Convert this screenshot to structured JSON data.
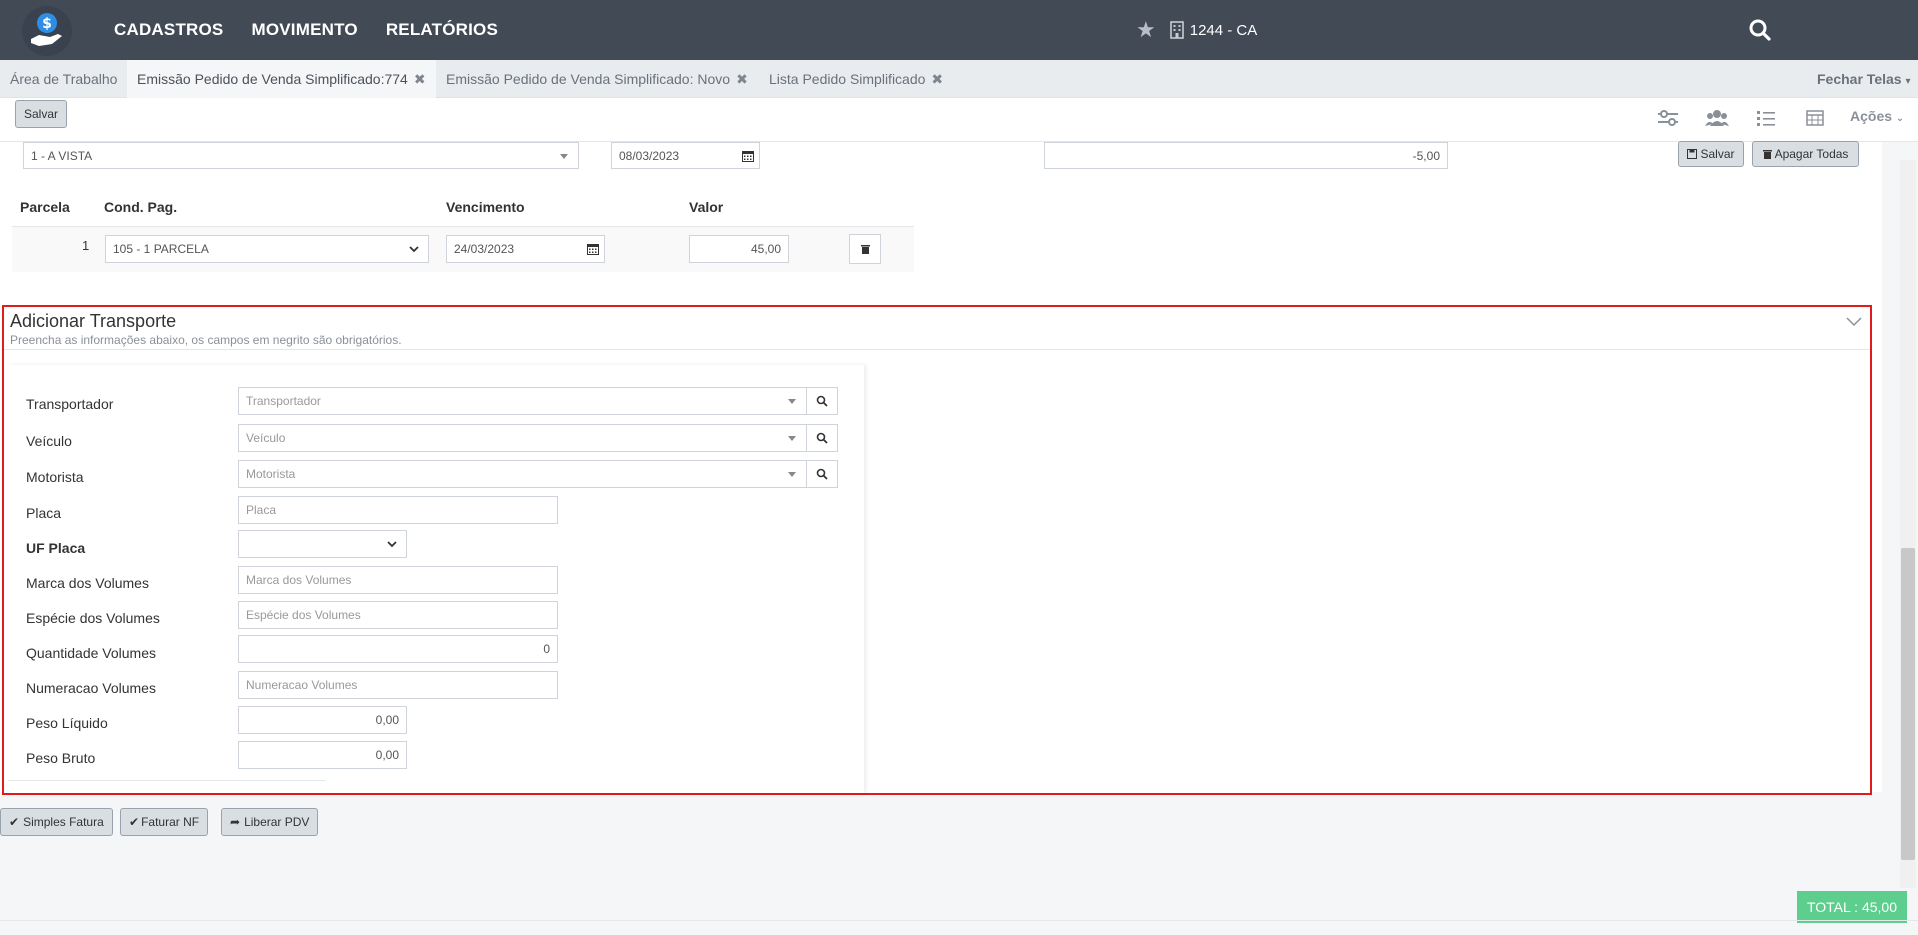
{
  "nav": {
    "menu": [
      "CADASTROS",
      "MOVIMENTO",
      "RELATÓRIOS"
    ],
    "company": "1244 - CA"
  },
  "tabs": {
    "items": [
      {
        "label": "Área de Trabalho"
      },
      {
        "label": "Emissão Pedido de Venda Simplificado:774"
      },
      {
        "label": "Emissão Pedido de Venda Simplificado: Novo"
      },
      {
        "label": "Lista Pedido Simplificado"
      }
    ],
    "close_all": "Fechar Telas"
  },
  "toolbar": {
    "save": "Salvar",
    "actions": "Ações"
  },
  "payment": {
    "cond_top": "1 - A VISTA",
    "date_top": "08/03/2023",
    "value_top": "-5,00",
    "save_btn": "Salvar",
    "delete_all_btn": "Apagar Todas",
    "headers": {
      "parcela": "Parcela",
      "cond": "Cond. Pag.",
      "venc": "Vencimento",
      "valor": "Valor"
    },
    "rows": [
      {
        "parcela": "1",
        "cond": "105 - 1 PARCELA",
        "venc": "24/03/2023",
        "valor": "45,00"
      }
    ]
  },
  "transport": {
    "title": "Adicionar Transporte",
    "subtitle": "Preencha as informações abaixo, os campos em negrito são obrigatórios.",
    "fields": {
      "transportador": {
        "label": "Transportador",
        "placeholder": "Transportador"
      },
      "veiculo": {
        "label": "Veículo",
        "placeholder": "Veículo"
      },
      "motorista": {
        "label": "Motorista",
        "placeholder": "Motorista"
      },
      "placa": {
        "label": "Placa",
        "placeholder": "Placa"
      },
      "uf_placa": {
        "label": "UF Placa"
      },
      "marca": {
        "label": "Marca dos Volumes",
        "placeholder": "Marca dos Volumes"
      },
      "especie": {
        "label": "Espécie dos Volumes",
        "placeholder": "Espécie dos Volumes"
      },
      "quantidade": {
        "label": "Quantidade Volumes",
        "value": "0"
      },
      "numeracao": {
        "label": "Numeracao Volumes",
        "placeholder": "Numeracao Volumes"
      },
      "peso_liquido": {
        "label": "Peso Líquido",
        "value": "0,00"
      },
      "peso_bruto": {
        "label": "Peso Bruto",
        "value": "0,00"
      }
    }
  },
  "bottom": {
    "simples_fatura": "Simples Fatura",
    "faturar_nf": "Faturar NF",
    "liberar_pdv": "Liberar PDV"
  },
  "total": "TOTAL : 45,00"
}
